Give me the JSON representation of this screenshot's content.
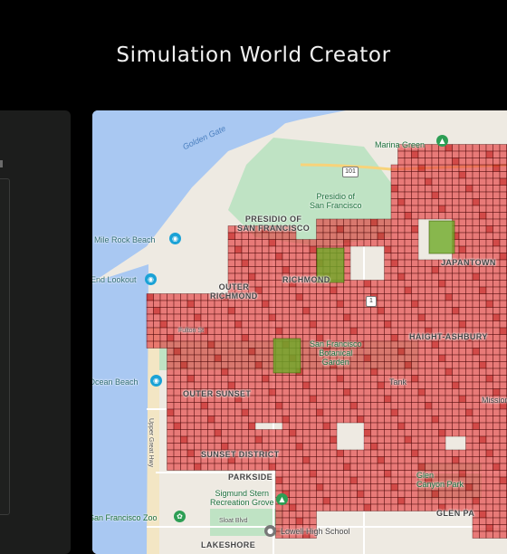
{
  "header": {
    "title": "Simulation World Creator"
  },
  "map": {
    "labels": {
      "golden_gate": "Golden Gate",
      "marina_green": "Marina Green",
      "presidio": "Presidio of\nSan Francisco",
      "presidio_district": "PRESIDIO OF\nSAN FRANCISCO",
      "mile_rock": "Mile Rock Beach",
      "end_lookout": "End Lookout",
      "richmond": "RICHMOND",
      "outer_richmond": "OUTER\nRICHMOND",
      "fulton": "Fulton St",
      "botanical": "San Francisco\nBotanical\nGarden",
      "haight": "HAIGHT-ASHBURY",
      "japantown": "JAPANTOWN",
      "ocean_beach": "Ocean Beach",
      "outer_sunset": "OUTER SUNSET",
      "sunset_district": "SUNSET DISTRICT",
      "parkside": "PARKSIDE",
      "sigmund": "Sigmund Stern\nRecreation Grove",
      "zoo": "San Francisco Zoo",
      "sloat": "Sloat Blvd",
      "lowell": "Lowell High School",
      "lakeshore": "LAKESHORE",
      "glen_canyon": "Glen\nCanyon Park",
      "glen_park": "GLEN PA",
      "mission": "Mission",
      "tank": "Tank",
      "great_hwy": "Upper Great Hwy",
      "hwy101": "101",
      "hwy1": "1"
    },
    "icons": [
      "tree-pin-icon",
      "camera-pin-icon",
      "zoo-pin-icon",
      "school-pin-icon"
    ]
  }
}
